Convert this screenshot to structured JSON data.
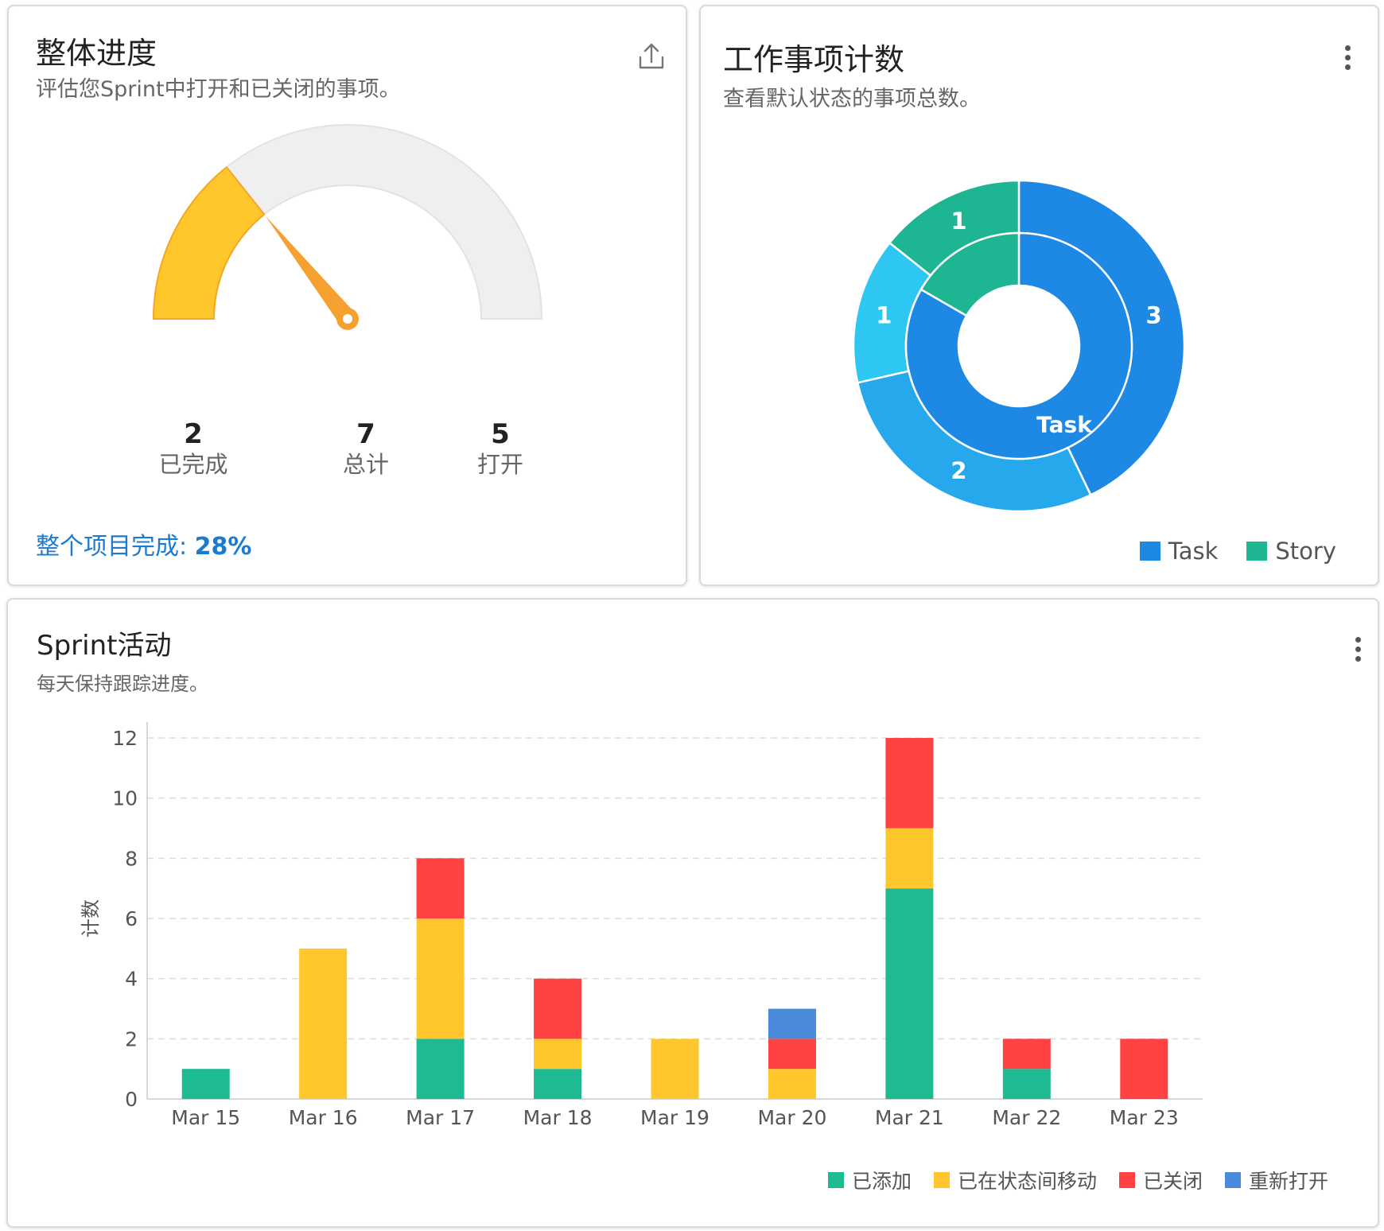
{
  "progress_card": {
    "title": "整体进度",
    "subtitle": "评估您Sprint中打开和已关闭的事项。",
    "export_icon": "export-upload-icon",
    "stats": [
      {
        "value": "2",
        "label": "已完成"
      },
      {
        "value": "7",
        "label": "总计"
      },
      {
        "value": "5",
        "label": "打开"
      }
    ],
    "completion_label": "整个项目完成:",
    "completion_value": "28%",
    "colors": {
      "filled": "#FFC72C",
      "track": "#EFEFEF",
      "needle": "#F5A030"
    }
  },
  "count_card": {
    "title": "工作事项计数",
    "subtitle": "查看默认状态的事项总数。",
    "menu_icon": "more-vert-icon",
    "legend": [
      {
        "label": "Task",
        "color": "#1E88E5"
      },
      {
        "label": "Story",
        "color": "#1DB592"
      }
    ]
  },
  "activity_card": {
    "title": "Sprint活动",
    "subtitle": "每天保持跟踪进度。",
    "menu_icon": "more-vert-icon"
  },
  "chart_data": [
    {
      "type": "gauge",
      "value": 2,
      "max": 7,
      "fraction": 0.28,
      "stats": {
        "已完成": 2,
        "总计": 7,
        "打开": 5
      }
    },
    {
      "type": "donut",
      "inner": [
        {
          "label": "Task",
          "value": 5,
          "color": "#1E88E5"
        },
        {
          "label": "",
          "value": 1,
          "color": "#1DB592"
        }
      ],
      "outer": [
        {
          "label": "3",
          "value": 3,
          "color": "#1E88E5"
        },
        {
          "label": "2",
          "value": 2,
          "color": "#25A8EC"
        },
        {
          "label": "1",
          "value": 1,
          "color": "#2DC7F2"
        },
        {
          "label": "1",
          "value": 1,
          "color": "#1DB592"
        }
      ],
      "legend": [
        "Task",
        "Story"
      ],
      "legend_position": "bottom-right"
    },
    {
      "type": "bar",
      "stacked": true,
      "categories": [
        "Mar 15",
        "Mar 16",
        "Mar 17",
        "Mar 18",
        "Mar 19",
        "Mar 20",
        "Mar 21",
        "Mar 22",
        "Mar 23"
      ],
      "series": [
        {
          "name": "已添加",
          "color": "#1DBA94",
          "values": [
            1,
            0,
            2,
            1,
            0,
            0,
            7,
            1,
            0
          ]
        },
        {
          "name": "已在状态间移动",
          "color": "#FFC72C",
          "values": [
            0,
            5,
            4,
            1,
            2,
            1,
            2,
            0,
            0
          ]
        },
        {
          "name": "已关闭",
          "color": "#FF4242",
          "values": [
            0,
            0,
            2,
            2,
            0,
            1,
            3,
            1,
            2
          ]
        },
        {
          "name": "重新打开",
          "color": "#4A8ADA",
          "values": [
            0,
            0,
            0,
            0,
            0,
            1,
            0,
            0,
            0
          ]
        }
      ],
      "ylabel": "计数",
      "xlabel": "",
      "ylim": [
        0,
        12
      ],
      "yticks": [
        0,
        2,
        4,
        6,
        8,
        10,
        12
      ],
      "grid": true,
      "legend_position": "bottom-right"
    }
  ]
}
